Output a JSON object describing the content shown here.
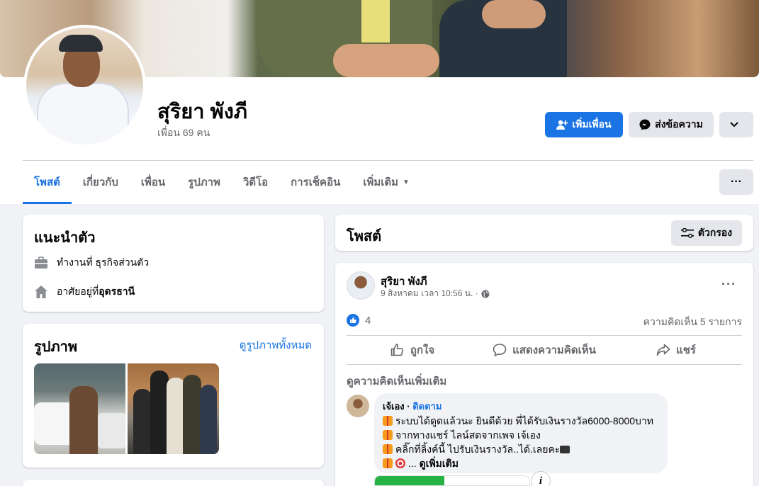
{
  "profile": {
    "name": "สุริยา พังภี",
    "friends": "เพื่อน 69 คน"
  },
  "actions": {
    "add_friend": "เพิ่มเพื่อน",
    "message": "ส่งข้อความ"
  },
  "tabs": [
    {
      "label": "โพสต์",
      "active": true
    },
    {
      "label": "เกี่ยวกับ"
    },
    {
      "label": "เพื่อน"
    },
    {
      "label": "รูปภาพ"
    },
    {
      "label": "วิดีโอ"
    },
    {
      "label": "การเช็คอิน"
    },
    {
      "label": "เพิ่มเติม"
    }
  ],
  "intro": {
    "title": "แนะนำตัว",
    "work": "ทำงานที่ ธุรกิจส่วนตัว",
    "lives_prefix": "อาศัยอยู่ที่ ",
    "lives_city": "อุดรธานี"
  },
  "photos": {
    "title": "รูปภาพ",
    "see_all": "ดูรูปภาพทั้งหมด"
  },
  "posts_header": {
    "title": "โพสต์",
    "filter": "ตัวกรอง"
  },
  "post": {
    "author": "สุริยา พังภี",
    "date": "9 สิงหาคม เวลา 10:56 น. ·",
    "like_count": "4",
    "comment_count": "ความคิดเห็น 5 รายการ",
    "like_label": "ถูกใจ",
    "comment_label": "แสดงความคิดเห็น",
    "share_label": "แชร์",
    "more_comments": "ดูความคิดเห็นเพิ่มเติม"
  },
  "comment": {
    "author": "เจ้เอง",
    "follow": "ติดตาม",
    "line1": "ระบบได้ดูดแล้วนะ ยินดีด้วย พี่ได้รับเงินรางวัล6000-8000บาท",
    "line2": "จากทางแชร์ ไลน์สดจากเพจ เจ้เอง",
    "line3": "คลิ๊กที่ลิ้งค์นี้ ไปรับเงินรางวัล..ได้.เลยคะ",
    "line4_prefix": "... ",
    "see_more": "ดูเพิ่มเติม"
  },
  "colors": {
    "accent": "#1b74e4",
    "background": "#f0f2f5"
  }
}
